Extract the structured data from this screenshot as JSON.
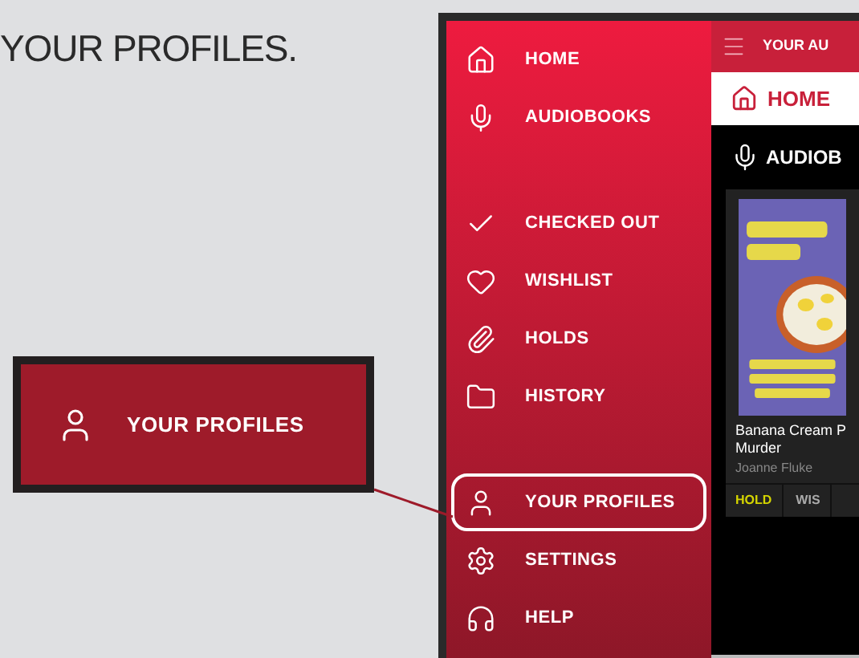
{
  "heading": "YOUR PROFILES.",
  "callout": {
    "label": "YOUR PROFILES"
  },
  "sidebar": {
    "groups": [
      {
        "items": [
          {
            "label": "HOME",
            "selected": false
          },
          {
            "label": "AUDIOBOOKS",
            "selected": false
          }
        ]
      },
      {
        "items": [
          {
            "label": "CHECKED OUT",
            "selected": false
          },
          {
            "label": "WISHLIST",
            "selected": false
          },
          {
            "label": "HOLDS",
            "selected": false
          },
          {
            "label": "HISTORY",
            "selected": false
          }
        ]
      },
      {
        "items": [
          {
            "label": "YOUR PROFILES",
            "selected": true
          },
          {
            "label": "SETTINGS",
            "selected": false
          },
          {
            "label": "HELP",
            "selected": false
          }
        ]
      }
    ]
  },
  "app": {
    "top_bar": {
      "title": "YOUR AU"
    },
    "home_bar": {
      "label": "HOME"
    },
    "section": {
      "title": "AUDIOB"
    },
    "book": {
      "title_lines": [
        "Banana Cream P",
        "Murder"
      ],
      "author": "Joanne Fluke",
      "actions": [
        "HOLD",
        "WIS"
      ]
    }
  }
}
